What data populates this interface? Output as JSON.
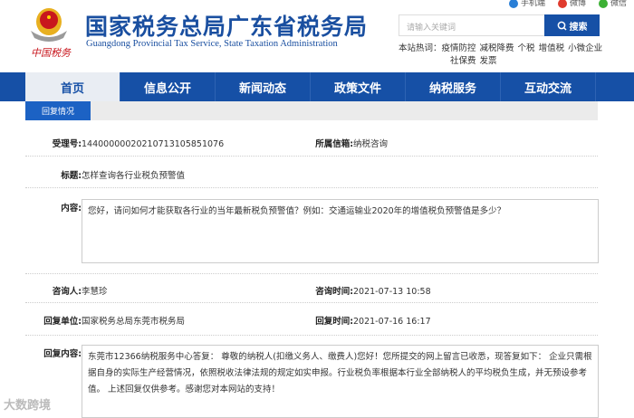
{
  "header": {
    "title_cn": "国家税务总局广东省税务局",
    "title_en": "Guangdong Provincial Tax Service, State Taxation Administration",
    "slogan": "中国税务",
    "links": [
      {
        "label": "手机端",
        "icon": "phone-icon",
        "color": "#2a7fd6"
      },
      {
        "label": "微博",
        "icon": "weibo-icon",
        "color": "#e03b2e"
      },
      {
        "label": "微信",
        "icon": "wechat-icon",
        "color": "#3cb034"
      }
    ],
    "search_placeholder": "请输入关键词",
    "search_button": "搜索",
    "hot_label": "本站热词：",
    "hot_words": [
      "疫情防控",
      "减税降费",
      "个税",
      "增值税",
      "小微企业",
      "社保费",
      "发票"
    ]
  },
  "nav": [
    "首页",
    "信息公开",
    "新闻动态",
    "政策文件",
    "纳税服务",
    "互动交流"
  ],
  "subnav": "回复情况",
  "detail": {
    "accept_no_label": "受理号:",
    "accept_no": "14400000020210713105851076",
    "mailbox_label": "所属信箱:",
    "mailbox": "纳税咨询",
    "title_label": "标题:",
    "title": "怎样查询各行业税负预警值",
    "content_label": "内容:",
    "content": "您好，请问如何才能获取各行业的当年最新税负预警值？例如：交通运输业2020年的增值税负预警值是多少？",
    "asker_label": "咨询人:",
    "asker": "李慧珍",
    "ask_time_label": "咨询时间:",
    "ask_time": "2021-07-13 10:58",
    "reply_unit_label": "回复单位:",
    "reply_unit": "国家税务总局东莞市税务局",
    "reply_time_label": "回复时间:",
    "reply_time": "2021-07-16 16:17",
    "reply_label": "回复内容:",
    "reply": "东莞市12366纳税服务中心答复： 尊敬的纳税人(扣缴义务人、缴费人)您好！您所提交的网上留言已收悉，现答复如下： 企业只需根据自身的实际生产经营情况，依照税收法律法规的规定如实申报。行业税负率根据本行业全部纳税人的平均税负生成，并无预设参考值。 上述回复仅供参考。感谢您对本网站的支持！"
  },
  "watermark": "大数跨境"
}
